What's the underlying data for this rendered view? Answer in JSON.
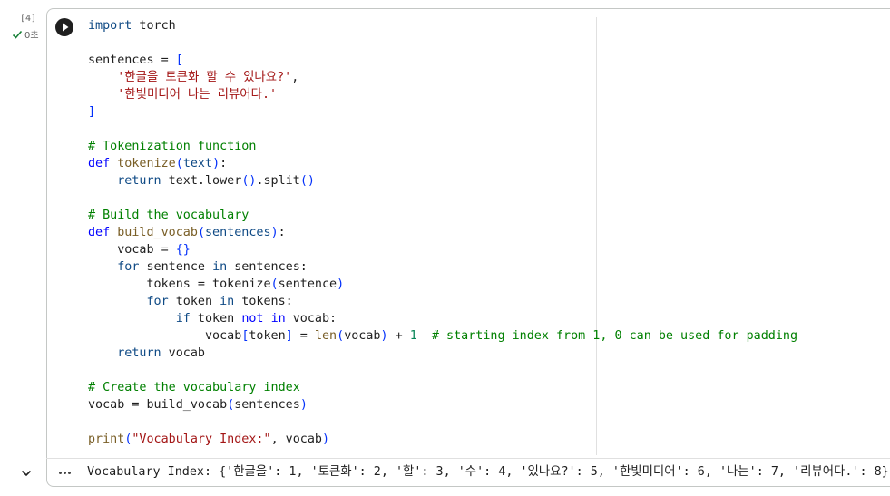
{
  "cell": {
    "execution_count": "[4]",
    "exec_time": "0초",
    "lines": [
      [
        {
          "t": "import",
          "c": "kw2"
        },
        {
          "t": " torch",
          "c": ""
        }
      ],
      [],
      [
        {
          "t": "sentences = ",
          "c": ""
        },
        {
          "t": "[",
          "c": "br"
        }
      ],
      [
        {
          "t": "    ",
          "c": ""
        },
        {
          "t": "'한글을 토큰화 할 수 있나요?'",
          "c": "str"
        },
        {
          "t": ",",
          "c": ""
        }
      ],
      [
        {
          "t": "    ",
          "c": ""
        },
        {
          "t": "'한빛미디어 나는 리뷰어다.'",
          "c": "str"
        }
      ],
      [
        {
          "t": "]",
          "c": "br"
        }
      ],
      [],
      [
        {
          "t": "# Tokenization function",
          "c": "cm"
        }
      ],
      [
        {
          "t": "def",
          "c": "kw"
        },
        {
          "t": " ",
          "c": ""
        },
        {
          "t": "tokenize",
          "c": "fn"
        },
        {
          "t": "(",
          "c": "br"
        },
        {
          "t": "text",
          "c": "kw2"
        },
        {
          "t": ")",
          "c": "br"
        },
        {
          "t": ":",
          "c": ""
        }
      ],
      [
        {
          "t": "    ",
          "c": ""
        },
        {
          "t": "return",
          "c": "kw2"
        },
        {
          "t": " text.lower",
          "c": ""
        },
        {
          "t": "()",
          "c": "br"
        },
        {
          "t": ".split",
          "c": ""
        },
        {
          "t": "()",
          "c": "br"
        }
      ],
      [],
      [
        {
          "t": "# Build the vocabulary",
          "c": "cm"
        }
      ],
      [
        {
          "t": "def",
          "c": "kw"
        },
        {
          "t": " ",
          "c": ""
        },
        {
          "t": "build_vocab",
          "c": "fn"
        },
        {
          "t": "(",
          "c": "br"
        },
        {
          "t": "sentences",
          "c": "kw2"
        },
        {
          "t": ")",
          "c": "br"
        },
        {
          "t": ":",
          "c": ""
        }
      ],
      [
        {
          "t": "    vocab = ",
          "c": ""
        },
        {
          "t": "{}",
          "c": "br"
        }
      ],
      [
        {
          "t": "    ",
          "c": ""
        },
        {
          "t": "for",
          "c": "kw2"
        },
        {
          "t": " sentence ",
          "c": ""
        },
        {
          "t": "in",
          "c": "kw2"
        },
        {
          "t": " sentences:",
          "c": ""
        }
      ],
      [
        {
          "t": "        tokens = tokenize",
          "c": ""
        },
        {
          "t": "(",
          "c": "br"
        },
        {
          "t": "sentence",
          "c": ""
        },
        {
          "t": ")",
          "c": "br"
        }
      ],
      [
        {
          "t": "        ",
          "c": ""
        },
        {
          "t": "for",
          "c": "kw2"
        },
        {
          "t": " token ",
          "c": ""
        },
        {
          "t": "in",
          "c": "kw2"
        },
        {
          "t": " tokens:",
          "c": ""
        }
      ],
      [
        {
          "t": "            ",
          "c": ""
        },
        {
          "t": "if",
          "c": "kw2"
        },
        {
          "t": " token ",
          "c": ""
        },
        {
          "t": "not",
          "c": "kw"
        },
        {
          "t": " ",
          "c": ""
        },
        {
          "t": "in",
          "c": "kw"
        },
        {
          "t": " vocab:",
          "c": ""
        }
      ],
      [
        {
          "t": "                vocab",
          "c": ""
        },
        {
          "t": "[",
          "c": "br"
        },
        {
          "t": "token",
          "c": ""
        },
        {
          "t": "]",
          "c": "br"
        },
        {
          "t": " = ",
          "c": ""
        },
        {
          "t": "len",
          "c": "fn"
        },
        {
          "t": "(",
          "c": "br"
        },
        {
          "t": "vocab",
          "c": ""
        },
        {
          "t": ")",
          "c": "br"
        },
        {
          "t": " + ",
          "c": ""
        },
        {
          "t": "1",
          "c": "num"
        },
        {
          "t": "  # starting index from 1, 0 can be used for padding",
          "c": "cm"
        }
      ],
      [
        {
          "t": "    ",
          "c": ""
        },
        {
          "t": "return",
          "c": "kw2"
        },
        {
          "t": " vocab",
          "c": ""
        }
      ],
      [],
      [
        {
          "t": "# Create the vocabulary index",
          "c": "cm"
        }
      ],
      [
        {
          "t": "vocab = build_vocab",
          "c": ""
        },
        {
          "t": "(",
          "c": "br"
        },
        {
          "t": "sentences",
          "c": ""
        },
        {
          "t": ")",
          "c": "br"
        }
      ],
      [],
      [
        {
          "t": "print",
          "c": "fn"
        },
        {
          "t": "(",
          "c": "br"
        },
        {
          "t": "\"Vocabulary Index:\"",
          "c": "str"
        },
        {
          "t": ", vocab",
          "c": ""
        },
        {
          "t": ")",
          "c": "br"
        }
      ]
    ]
  },
  "output": {
    "text": "Vocabulary Index: {'한글을': 1, '토큰화': 2, '할': 3, '수': 4, '있나요?': 5, '한빛미디어': 6, '나는': 7, '리뷰어다.': 8}"
  },
  "icons": {
    "run": "play-circle-icon",
    "status": "check-icon",
    "collapse": "chevron-down-icon",
    "output_menu": "more-horiz-icon"
  },
  "colors": {
    "keyword": "#0000ff",
    "keyword_flow": "#0f4a85",
    "string": "#a31515",
    "comment": "#008000",
    "number": "#098658",
    "function": "#795e26",
    "bracket": "#0431fa",
    "success": "#188038"
  }
}
